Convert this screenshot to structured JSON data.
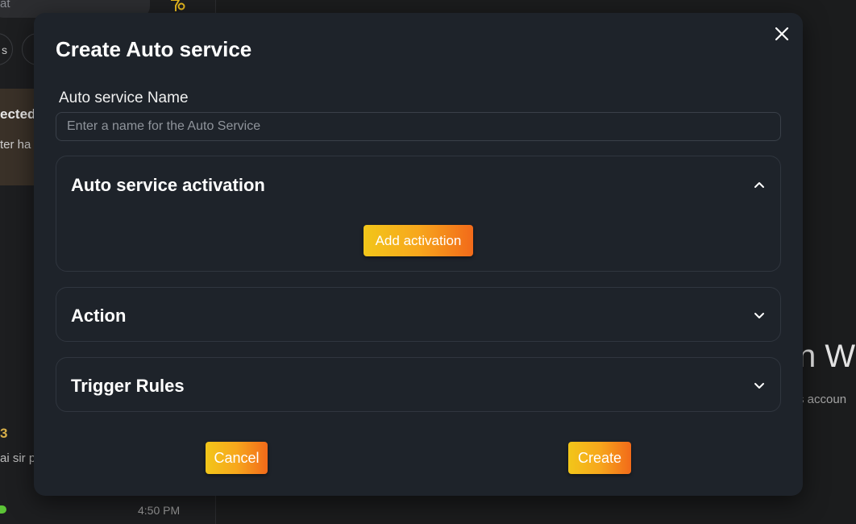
{
  "background": {
    "search_text": "at",
    "chip_1": "s",
    "card_title": "ected",
    "card_subtitle": "ter ha",
    "item_number": "3",
    "item_message": "ai sir p",
    "item_time": "4:50 PM",
    "welcome_heading": "n W",
    "welcome_subtext": "s accoun"
  },
  "modal": {
    "title": "Create Auto service",
    "close_icon": "close-icon",
    "name_field": {
      "label": "Auto service Name",
      "value": "",
      "placeholder": "Enter a name for the Auto Service"
    },
    "sections": {
      "activation": {
        "title": "Auto service activation",
        "expanded": true,
        "add_button_label": "Add activation"
      },
      "action": {
        "title": "Action",
        "expanded": false
      },
      "trigger_rules": {
        "title": "Trigger Rules",
        "expanded": false
      }
    },
    "cancel_label": "Cancel",
    "create_label": "Create"
  },
  "colors": {
    "modal_bg": "#1e232a",
    "accent_gradient_start": "#f2c61a",
    "accent_gradient_end": "#f26a1a",
    "border": "#30363f"
  }
}
